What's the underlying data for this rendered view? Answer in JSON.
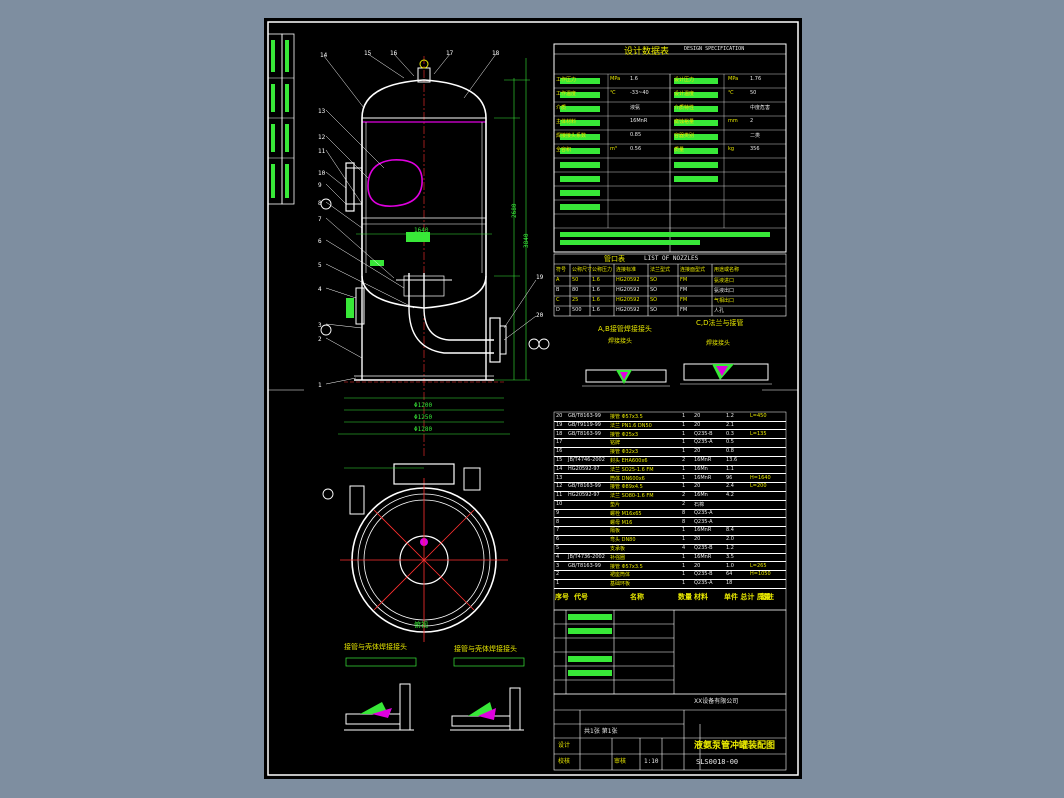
{
  "colors": {
    "background": "#7e8ea0",
    "sheet": "#000000",
    "outline": "#ffffff",
    "accent_yellow": "#e8e800",
    "accent_green": "#38e838",
    "accent_red": "#ff3030",
    "accent_magenta": "#e000e0"
  },
  "drawing": {
    "title": "液氨泵管冲罐装配图",
    "drawing_number": "SLS0018-00",
    "design_table_title": "设计数据表",
    "design_table_title_en": "DESIGN SPECIFICATION",
    "nozzle_table_title": "管口表",
    "nozzle_table_title_en": "LIST OF NOZZLES",
    "detail_ab_title": "A,B接管焊接接头",
    "detail_cd_title": "C,D法兰与接管",
    "detail_sub": "焊接接头",
    "bottom_detail_left": "接管与壳体焊接接头",
    "bottom_detail_right": "接管与壳体焊接接头",
    "view_label": "俯视",
    "parts_header": {
      "seq": "序号",
      "code": "代号",
      "name": "名称",
      "qty": "数量",
      "material": "材料",
      "weight": "单件 总计 质量",
      "remark": "备注"
    },
    "parts_rows": [
      {
        "seq": "20",
        "code": "GB/T8163-99",
        "name": "接管 Φ57x3.5",
        "qty": "1",
        "material": "20",
        "w": "1.2",
        "remark": "L=450"
      },
      {
        "seq": "19",
        "code": "GB/T9119-99",
        "name": "法兰 PN1.6 DN50",
        "qty": "1",
        "material": "20",
        "w": "2.1",
        "remark": ""
      },
      {
        "seq": "18",
        "code": "GB/T8163-99",
        "name": "接管 Φ25x3",
        "qty": "1",
        "material": "Q235-B",
        "w": "0.3",
        "remark": "L=135"
      },
      {
        "seq": "17",
        "code": "",
        "name": "铭牌",
        "qty": "1",
        "material": "Q235-A",
        "w": "0.5",
        "remark": ""
      },
      {
        "seq": "16",
        "code": "",
        "name": "接管 Φ32x3",
        "qty": "1",
        "material": "20",
        "w": "0.8",
        "remark": ""
      },
      {
        "seq": "15",
        "code": "JB/T4746-2002",
        "name": "封头 EHA600x6",
        "qty": "2",
        "material": "16MnR",
        "w": "13.6",
        "remark": ""
      },
      {
        "seq": "14",
        "code": "HG20592-97",
        "name": "法兰 SO25-1.6 FM",
        "qty": "1",
        "material": "16Mn",
        "w": "1.1",
        "remark": ""
      },
      {
        "seq": "13",
        "code": "",
        "name": "筒体 DN600x6",
        "qty": "1",
        "material": "16MnR",
        "w": "96",
        "remark": "H=1640"
      },
      {
        "seq": "12",
        "code": "GB/T8163-99",
        "name": "接管 Φ89x4.5",
        "qty": "1",
        "material": "20",
        "w": "2.4",
        "remark": "L=200"
      },
      {
        "seq": "11",
        "code": "HG20592-97",
        "name": "法兰 SO80-1.6 FM",
        "qty": "2",
        "material": "16Mn",
        "w": "4.2",
        "remark": ""
      },
      {
        "seq": "10",
        "code": "",
        "name": "垫片",
        "qty": "2",
        "material": "石棉",
        "w": "",
        "remark": ""
      },
      {
        "seq": "9",
        "code": "",
        "name": "螺栓 M16x65",
        "qty": "8",
        "material": "Q235-A",
        "w": "",
        "remark": ""
      },
      {
        "seq": "8",
        "code": "",
        "name": "螺母 M16",
        "qty": "8",
        "material": "Q235-A",
        "w": "",
        "remark": ""
      },
      {
        "seq": "7",
        "code": "",
        "name": "隔板",
        "qty": "1",
        "material": "16MnR",
        "w": "8.4",
        "remark": ""
      },
      {
        "seq": "6",
        "code": "",
        "name": "弯头 DN80",
        "qty": "1",
        "material": "20",
        "w": "2.0",
        "remark": ""
      },
      {
        "seq": "5",
        "code": "",
        "name": "支承板",
        "qty": "4",
        "material": "Q235-B",
        "w": "1.2",
        "remark": ""
      },
      {
        "seq": "4",
        "code": "JB/T4736-2002",
        "name": "补强圈",
        "qty": "1",
        "material": "16MnR",
        "w": "3.5",
        "remark": ""
      },
      {
        "seq": "3",
        "code": "GB/T8163-99",
        "name": "接管 Φ57x3.5",
        "qty": "1",
        "material": "20",
        "w": "1.0",
        "remark": "L=265"
      },
      {
        "seq": "2",
        "code": "",
        "name": "裙座筒体",
        "qty": "1",
        "material": "Q235-B",
        "w": "64",
        "remark": "H=1050"
      },
      {
        "seq": "1",
        "code": "",
        "name": "基础环板",
        "qty": "1",
        "material": "Q235-A",
        "w": "18",
        "remark": ""
      }
    ],
    "nozzle_header": [
      "符号",
      "公称尺寸",
      "公称压力",
      "连接标准",
      "法兰型式",
      "连接面型式",
      "用途或名称"
    ],
    "nozzle_rows": [
      [
        "A",
        "50",
        "1.6",
        "HG20592",
        "SO",
        "FM",
        "氨液进口"
      ],
      [
        "B",
        "80",
        "1.6",
        "HG20592",
        "SO",
        "FM",
        "氨液出口"
      ],
      [
        "C",
        "25",
        "1.6",
        "HG20592",
        "SO",
        "FM",
        "气相出口"
      ],
      [
        "D",
        "500",
        "1.6",
        "HG20592",
        "SO",
        "FM",
        "人孔"
      ]
    ],
    "design_rows": [
      [
        "工作压力",
        "MPa",
        "1.6",
        "设计压力",
        "MPa",
        "1.76"
      ],
      [
        "工作温度",
        "℃",
        "-33~40",
        "设计温度",
        "℃",
        "50"
      ],
      [
        "介质",
        "",
        "液氨",
        "介质特性",
        "",
        "中度危害"
      ],
      [
        "主体材料",
        "",
        "16MnR",
        "腐蚀裕量",
        "mm",
        "2"
      ],
      [
        "焊接接头系数",
        "",
        "0.85",
        "容器类别",
        "",
        "二类"
      ],
      [
        "全容积",
        "m³",
        "0.56",
        "质量",
        "kg",
        "356"
      ]
    ],
    "title_block": {
      "company": "XX设备有限公司",
      "scale": "1:10",
      "sheet": "共1张 第1张",
      "drawn": "设计",
      "checked": "校核",
      "approved": "审核"
    },
    "balloons": [
      "1",
      "2",
      "3",
      "4",
      "5",
      "6",
      "7",
      "8",
      "9",
      "10",
      "11",
      "12",
      "13",
      "14",
      "15",
      "16",
      "17",
      "18",
      "19",
      "20"
    ]
  }
}
